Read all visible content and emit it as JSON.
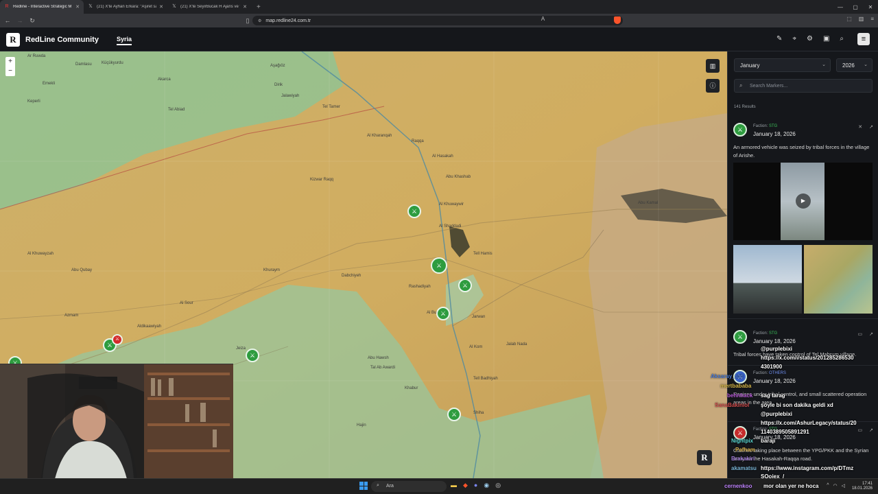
{
  "browser": {
    "tabs": [
      {
        "label": "Redline - Interactive Strategic M",
        "active": true,
        "icon": "redline-favicon"
      },
      {
        "label": "(21) X'te Ayhan Erkara: \"Aşiret savaş",
        "active": false,
        "icon": "x-favicon"
      },
      {
        "label": "(21) X'te SeyirBucak H Ajans ve \"Suri",
        "active": false,
        "icon": "x-favicon"
      }
    ],
    "url": "map.redline24.com.tr"
  },
  "app": {
    "logo_letter": "R",
    "title": "RedLine Community",
    "region": "Syria"
  },
  "map": {
    "zoom_in": "+",
    "zoom_out": "−",
    "places": [
      {
        "name": "Ar Ruwda",
        "x": 1
      },
      {
        "name": "Damlasu",
        "x": 2
      },
      {
        "name": "Küçükyurdu",
        "x": 3
      },
      {
        "name": "Emekli",
        "x": 4
      },
      {
        "name": "Aşağıöz",
        "x": 5
      },
      {
        "name": "Akarca",
        "x": 6
      },
      {
        "name": "Keperli",
        "x": 7
      },
      {
        "name": "Tel Abiad",
        "x": 8
      },
      {
        "name": "Dirik",
        "x": 9
      },
      {
        "name": "Jalawiyah",
        "x": 10
      },
      {
        "name": "Al Khuwayzah",
        "x": 11
      },
      {
        "name": "Abu Qubay",
        "x": 12
      },
      {
        "name": "Al Kharanqah",
        "x": 13
      },
      {
        "name": "Tel Tamer",
        "x": 14
      },
      {
        "name": "Raqqa",
        "x": 15
      },
      {
        "name": "Al Hasakah",
        "x": 16
      },
      {
        "name": "Kizwar Raqq",
        "x": 17
      },
      {
        "name": "Abu Khashab",
        "x": 18
      },
      {
        "name": "Al Khuwaywir",
        "x": 19
      },
      {
        "name": "Al Shaddadi",
        "x": 20
      },
      {
        "name": "Tell Hamis",
        "x": 21
      },
      {
        "name": "Khuraym",
        "x": 22
      },
      {
        "name": "Dabchiyeh",
        "x": 23
      },
      {
        "name": "Rashadiyah",
        "x": 24
      },
      {
        "name": "Al Busayrah",
        "x": 25
      },
      {
        "name": "Jarwan",
        "x": 26
      },
      {
        "name": "Jalab Nada",
        "x": 27
      },
      {
        "name": "Azmam",
        "x": 28
      },
      {
        "name": "Aldikaawiyah",
        "x": 29
      },
      {
        "name": "Al Sour",
        "x": 30
      },
      {
        "name": "Jeiza",
        "x": 31
      },
      {
        "name": "Abu Hawsh",
        "x": 32
      },
      {
        "name": "Tal Ab Awardi",
        "x": 33
      },
      {
        "name": "Tell Badhiyah",
        "x": 34
      },
      {
        "name": "Khabur",
        "x": 35
      },
      {
        "name": "Al Kom",
        "x": 36
      },
      {
        "name": "Hajin",
        "x": 37
      },
      {
        "name": "Shiha",
        "x": 38
      },
      {
        "name": "Abu Kamal",
        "x": 39
      }
    ]
  },
  "sidebar": {
    "month": "January",
    "year": "2026",
    "search_placeholder": "Search Markers...",
    "results": "141 Results",
    "cards": [
      {
        "faction_label": "Faction:",
        "faction": "STG",
        "date": "January 18, 2026",
        "desc": "An armored vehicle was seized by tribal forces in the village of Arishe."
      },
      {
        "faction_label": "Faction:",
        "faction": "STG",
        "date": "January 18, 2026",
        "desc": "Tribal forces have taken control of Tel Mahrum village."
      },
      {
        "faction_label": "Faction:",
        "faction": "OTHERS",
        "date": "January 18, 2026",
        "desc": "Regions under tribal control, and small scattered operation areas in the area."
      },
      {
        "faction_label": "Faction:",
        "faction": "STG",
        "date": "January 18, 2026",
        "desc": "Clashes taking place between the YPG/PKK and the Syrian army on the Hasakah-Raqqa road."
      }
    ]
  },
  "chat": [
    {
      "user": "",
      "text": "@purplebixi"
    },
    {
      "user": "",
      "text": "https://x.com/i/status/201285286530"
    },
    {
      "user": "",
      "text": "4301900"
    },
    {
      "user": "Aksaray_sat",
      "text": ""
    },
    {
      "user": "mertbababa",
      "text": ""
    },
    {
      "user": "behnhack",
      "text": "sag tarag"
    },
    {
      "user": "",
      "text": "şöyle bi son dakika geldi xd"
    },
    {
      "user": "SanaBakiniol",
      "text": "@purplebixi"
    },
    {
      "user": "",
      "text": "https://x.com/AshurLegacy/status/20"
    },
    {
      "user": "",
      "text": "1140389505891291"
    },
    {
      "user": "Nightpix",
      "text": "baraji"
    },
    {
      "user": "Pafham",
      "text": ""
    },
    {
      "user": "Brakakiri",
      "text": ""
    },
    {
      "user": "akamatsu",
      "text": "https://www.instagram.com/p/DTmz"
    },
    {
      "user": "",
      "text": "SOojex_/"
    },
    {
      "user": "cernenkoo",
      "text": "mor olan yer ne hoca"
    }
  ],
  "taskbar": {
    "search_label": "Ara",
    "time": "17:41",
    "date": "18.01.2026"
  }
}
